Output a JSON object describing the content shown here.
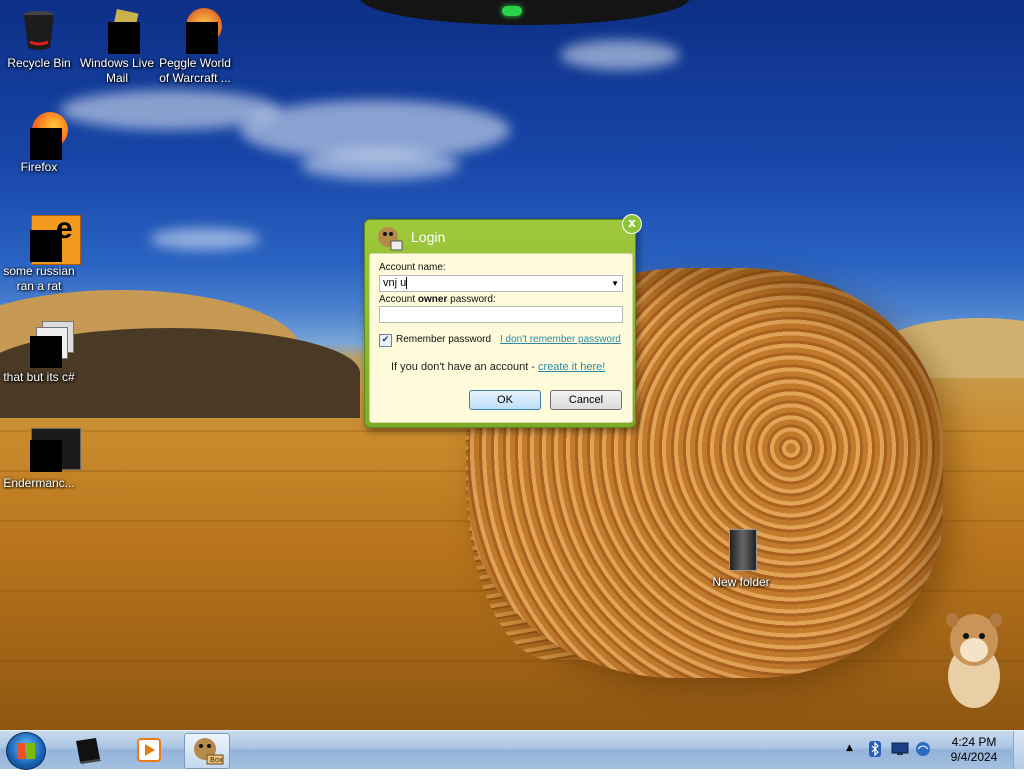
{
  "desktop": {
    "icons": [
      {
        "id": "recycle-bin",
        "label": "Recycle Bin",
        "icon": "recycle-bin-icon"
      },
      {
        "id": "windows-live-mail",
        "label": "Windows Live Mail",
        "icon": "mail-icon"
      },
      {
        "id": "peggle",
        "label": "Peggle World of Warcraft ...",
        "icon": "peggle-icon"
      },
      {
        "id": "firefox",
        "label": "Firefox",
        "icon": "firefox-icon"
      },
      {
        "id": "some-russian",
        "label": "some russian ran a rat",
        "icon": "app-icon"
      },
      {
        "id": "that-but-c",
        "label": "that but its c#",
        "icon": "app-icon"
      },
      {
        "id": "endermanc",
        "label": "Endermanc...",
        "icon": "app-icon"
      },
      {
        "id": "new-folder",
        "label": "New folder",
        "icon": "folder-icon"
      }
    ]
  },
  "login": {
    "title": "Login",
    "close_glyph": "x",
    "account_name_label": "Account name:",
    "account_name_value": "vnj u",
    "owner_password_label_pre": "Account ",
    "owner_password_label_bold": "owner",
    "owner_password_label_post": " password:",
    "owner_password_value": "",
    "remember_label": "Remember password",
    "remember_checked": true,
    "forgot_link": "I don't remember password",
    "no_account_text": "If you don't have an account - ",
    "create_link": "create it here!",
    "ok_label": "OK",
    "cancel_label": "Cancel"
  },
  "taskbar": {
    "pinned": [
      "cmd-icon",
      "media-player-icon",
      "box-app-icon"
    ],
    "active_app_label": "Box",
    "clock_time": "4:24 PM",
    "clock_date": "9/4/2024",
    "tray_icons": [
      "show-hidden-icon",
      "bluetooth-icon",
      "monitor-icon",
      "network-icon"
    ]
  },
  "colors": {
    "dialog_accent": "#8cc43a",
    "link": "#2e8aa6"
  }
}
